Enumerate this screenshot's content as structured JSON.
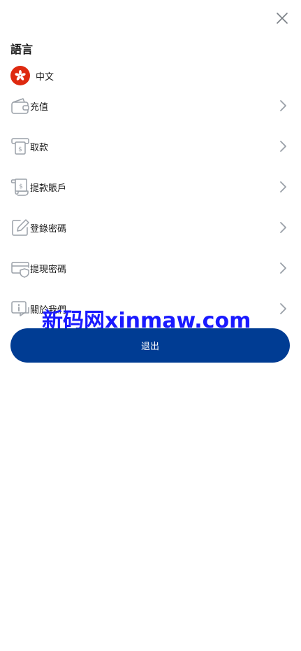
{
  "language_section": {
    "title": "語言",
    "current_language": "中文"
  },
  "menu": {
    "items": [
      {
        "label": "充值",
        "icon": "wallet-icon"
      },
      {
        "label": "取款",
        "icon": "atm-withdraw-icon"
      },
      {
        "label": "提款賬戶",
        "icon": "bank-account-icon"
      },
      {
        "label": "登錄密碼",
        "icon": "edit-password-icon"
      },
      {
        "label": "提現密碼",
        "icon": "card-shield-icon"
      },
      {
        "label": "關於我們",
        "icon": "info-chat-icon"
      }
    ]
  },
  "logout": {
    "label": "退出"
  },
  "watermark": {
    "text": "新码网xinmaw.com"
  },
  "colors": {
    "primary": "#003c93",
    "icon_gray": "#9aa0a8",
    "flag_red": "#de2910",
    "watermark_blue": "#1a1aff"
  }
}
